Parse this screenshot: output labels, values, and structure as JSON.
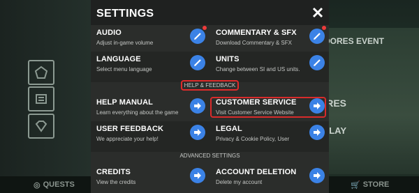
{
  "background": {
    "event_text": "DORES EVENT",
    "dres_text": "RES",
    "lay_text": "LAY",
    "bottom": {
      "left_label": "QUESTS",
      "right_label": "STORE"
    }
  },
  "settings": {
    "title": "SETTINGS",
    "close_icon": "close-icon",
    "rows": [
      {
        "left": {
          "title": "AUDIO",
          "desc": "Adjust in-game volume",
          "action": "edit",
          "badge": true
        },
        "right": {
          "title": "COMMENTARY & SFX",
          "desc": "Download Commentary & SFX",
          "action": "edit",
          "badge": true
        }
      },
      {
        "left": {
          "title": "LANGUAGE",
          "desc": "Select menu language",
          "action": "edit"
        },
        "right": {
          "title": "UNITS",
          "desc": "Change between SI and US units.",
          "action": "edit"
        }
      }
    ],
    "help_section": {
      "label": "HELP & FEEDBACK",
      "rows": [
        {
          "left": {
            "title": "HELP MANUAL",
            "desc": "Learn everything about the game",
            "action": "go"
          },
          "right": {
            "title": "CUSTOMER SERVICE",
            "desc": "Visit Customer Service Website",
            "action": "go"
          }
        },
        {
          "left": {
            "title": "USER FEEDBACK",
            "desc": "We appreciate your help!",
            "action": "go"
          },
          "right": {
            "title": "LEGAL",
            "desc": "Privacy & Cookie Policy, User",
            "action": "go"
          }
        }
      ]
    },
    "advanced_section": {
      "label": "ADVANCED SETTINGS",
      "rows": [
        {
          "left": {
            "title": "CREDITS",
            "desc": "View the credits",
            "action": "go"
          },
          "right": {
            "title": "ACCOUNT DELETION",
            "desc": "Delete my account",
            "action": "go"
          }
        }
      ]
    },
    "colors": {
      "accent_button": "#3b82e6",
      "highlight": "#d92b2b",
      "badge": "#ef3b3b"
    }
  }
}
